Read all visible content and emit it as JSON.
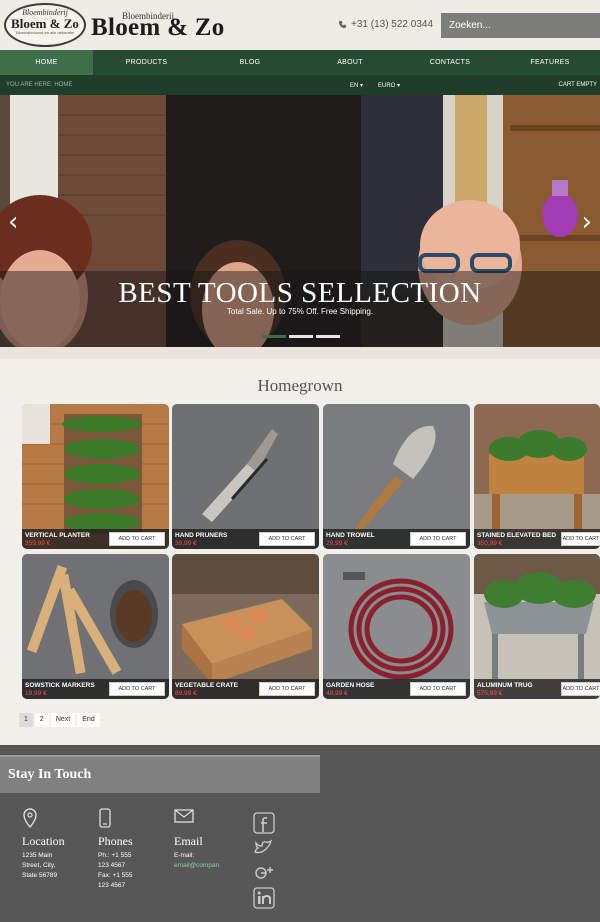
{
  "header": {
    "logo_top": "Bloembinderij",
    "logo_main": "Bloem & Zo",
    "logo_tagline": "Bloemsierkunst en alle dekoratie",
    "brand_small": "Bloembinderij",
    "brand_big": "Bloem & Zo",
    "phone": "+31 (13) 522 0344",
    "search_placeholder": "Zoeken..."
  },
  "nav": {
    "items": [
      "HOME",
      "PRODUCTS",
      "BLOG",
      "ABOUT",
      "CONTACTS",
      "FEATURES"
    ]
  },
  "subbar": {
    "breadcrumb": "YOU ARE HERE: HOME",
    "language": "EN ▾",
    "currency": "EURO ▾",
    "cart": "CART EMPTY"
  },
  "hero": {
    "title": "BEST TOOLS SELLECTION",
    "subtitle": "Total Sale. Up to 75% Off. Free Shipping.",
    "prev": "‹",
    "next": "›"
  },
  "section": {
    "title": "Homegrown"
  },
  "products": [
    {
      "name": "VERTICAL PLANTER",
      "price": "359,99 €",
      "button": "ADD TO CART"
    },
    {
      "name": "HAND PRUNERS",
      "price": "39,99 €",
      "button": "ADD TO CART"
    },
    {
      "name": "HAND TROWEL",
      "price": "29,99 €",
      "button": "ADD TO CART"
    },
    {
      "name": "STAINED ELEVATED BED",
      "price": "350,99 €",
      "button": "ADD TO CART"
    },
    {
      "name": "SOWSTICK MARKERS",
      "price": "19,99 €",
      "button": "ADD TO CART"
    },
    {
      "name": "VEGETABLE CRATE",
      "price": "89,99 €",
      "button": "ADD TO CART"
    },
    {
      "name": "GARDEN HOSE",
      "price": "49,99 €",
      "button": "ADD TO CART"
    },
    {
      "name": "ALUMINUM TRUG",
      "price": "575,99 €",
      "button": "ADD TO CART"
    }
  ],
  "pagination": [
    "1",
    "2",
    "Next",
    "End"
  ],
  "footer": {
    "heading": "Stay In Touch",
    "location_title": "Location",
    "location_lines": [
      "1235 Main",
      "Street, City,",
      "State 56789"
    ],
    "phones_title": "Phones",
    "phones_lines": [
      "Ph.: +1 555",
      "123 4567",
      "Fax: +1 555",
      "123 4567"
    ],
    "email_title": "Email",
    "email_label": "E-mail:",
    "email_value": "email@compan"
  },
  "icons": [
    "phone-icon",
    "location-icon",
    "mobile-icon",
    "mail-icon",
    "facebook-icon",
    "twitter-icon",
    "google-plus-icon",
    "linkedin-icon"
  ],
  "colors": {
    "nav": "#254c33",
    "nav_active": "#3f6f4a",
    "price": "#ff4a4a",
    "footer": "#575757"
  }
}
